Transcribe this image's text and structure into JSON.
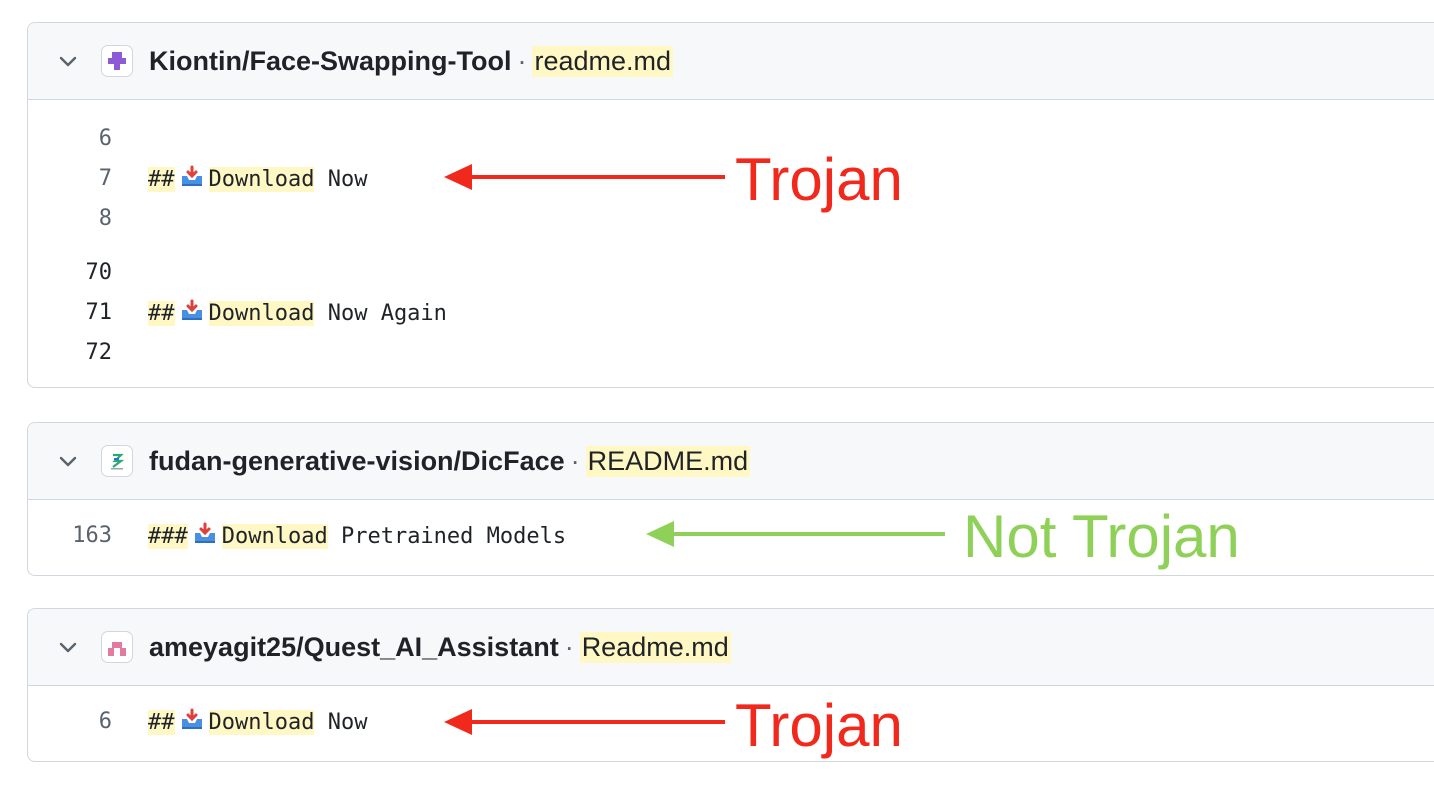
{
  "results": [
    {
      "repo": "Kiontin/Face-Swapping-Tool",
      "separator": "·",
      "file": "readme.md",
      "avatar_icon": "purple-identicon",
      "lines": [
        {
          "num": "6",
          "prefix": "",
          "keyword": "",
          "suffix": ""
        },
        {
          "num": "7",
          "prefix": "##",
          "keyword": "Download",
          "suffix": " Now"
        },
        {
          "num": "8",
          "prefix": "",
          "keyword": "",
          "suffix": ""
        },
        {
          "num": "70",
          "prefix": "",
          "keyword": "",
          "suffix": ""
        },
        {
          "num": "71",
          "prefix": "##",
          "keyword": "Download",
          "suffix": " Now Again"
        },
        {
          "num": "72",
          "prefix": "",
          "keyword": "",
          "suffix": ""
        }
      ]
    },
    {
      "repo": "fudan-generative-vision/DicFace",
      "separator": "·",
      "file": "README.md",
      "avatar_icon": "fudan-logo",
      "lines": [
        {
          "num": "163",
          "prefix": "###",
          "keyword": "Download",
          "suffix": " Pretrained Models"
        }
      ]
    },
    {
      "repo": "ameyagit25/Quest_AI_Assistant",
      "separator": "·",
      "file": "Readme.md",
      "avatar_icon": "pink-identicon",
      "lines": [
        {
          "num": "6",
          "prefix": "##",
          "keyword": "Download",
          "suffix": " Now"
        }
      ]
    }
  ],
  "annotations": [
    {
      "label": "Trojan",
      "color": "#f0291c"
    },
    {
      "label": "Not Trojan",
      "color": "#8fd158"
    },
    {
      "label": "Trojan",
      "color": "#f0291c"
    }
  ],
  "colors": {
    "highlight": "#fff8c5",
    "border": "#d0d7de",
    "header_bg": "#f6f8fa"
  }
}
